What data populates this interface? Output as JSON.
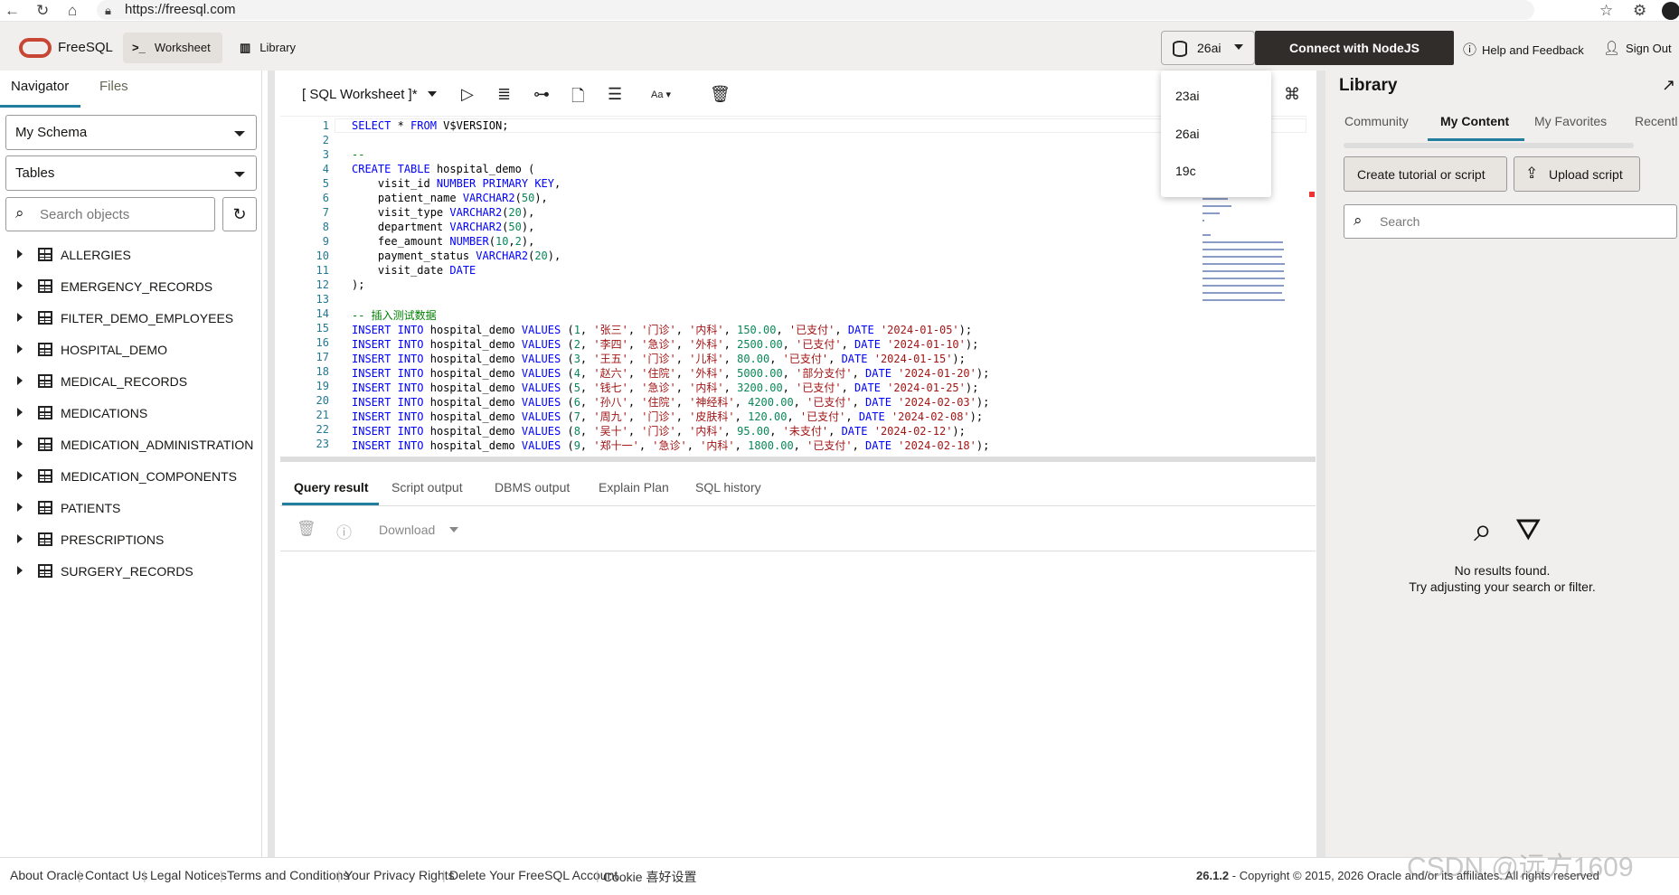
{
  "browser": {
    "url": "https://freesql.com"
  },
  "header": {
    "brand": "FreeSQL",
    "tabs": [
      {
        "label": "Worksheet",
        "icon": "terminal-icon"
      },
      {
        "label": "Library",
        "icon": "book-icon"
      }
    ],
    "db_version": "26ai",
    "connect_label": "Connect with NodeJS",
    "help_label": "Help and Feedback",
    "signout_label": "Sign Out"
  },
  "db_menu": {
    "options": [
      "23ai",
      "26ai",
      "19c"
    ]
  },
  "navigator": {
    "tabs": [
      "Navigator",
      "Files"
    ],
    "schema": "My Schema",
    "object_type": "Tables",
    "search_placeholder": "Search objects",
    "items": [
      "ALLERGIES",
      "EMERGENCY_RECORDS",
      "FILTER_DEMO_EMPLOYEES",
      "HOSPITAL_DEMO",
      "MEDICAL_RECORDS",
      "MEDICATIONS",
      "MEDICATION_ADMINISTRATION",
      "MEDICATION_COMPONENTS",
      "PATIENTS",
      "PRESCRIPTIONS",
      "SURGERY_RECORDS"
    ]
  },
  "worksheet": {
    "title": "[ SQL Worksheet ]*"
  },
  "editor": {
    "line_numbers": [
      "1",
      "2",
      "3",
      "4",
      "5",
      "6",
      "7",
      "8",
      "9",
      "10",
      "11",
      "12",
      "13",
      "14",
      "15",
      "16",
      "17",
      "18",
      "19",
      "20",
      "21",
      "22",
      "23"
    ],
    "lines": [
      "SELECT * FROM V$VERSION;",
      "",
      "--",
      "CREATE TABLE hospital_demo (",
      "    visit_id NUMBER PRIMARY KEY,",
      "    patient_name VARCHAR2(50),",
      "    visit_type VARCHAR2(20),",
      "    department VARCHAR2(50),",
      "    fee_amount NUMBER(10,2),",
      "    payment_status VARCHAR2(20),",
      "    visit_date DATE",
      ");",
      "",
      "-- 插入测试数据",
      "INSERT INTO hospital_demo VALUES (1, '张三', '门诊', '内科', 150.00, '已支付', DATE '2024-01-05');",
      "INSERT INTO hospital_demo VALUES (2, '李四', '急诊', '外科', 2500.00, '已支付', DATE '2024-01-10');",
      "INSERT INTO hospital_demo VALUES (3, '王五', '门诊', '儿科', 80.00, '已支付', DATE '2024-01-15');",
      "INSERT INTO hospital_demo VALUES (4, '赵六', '住院', '外科', 5000.00, '部分支付', DATE '2024-01-20');",
      "INSERT INTO hospital_demo VALUES (5, '钱七', '急诊', '内科', 3200.00, '已支付', DATE '2024-01-25');",
      "INSERT INTO hospital_demo VALUES (6, '孙八', '住院', '神经科', 4200.00, '已支付', DATE '2024-02-03');",
      "INSERT INTO hospital_demo VALUES (7, '周九', '门诊', '皮肤科', 120.00, '已支付', DATE '2024-02-08');",
      "INSERT INTO hospital_demo VALUES (8, '吴十', '门诊', '内科', 95.00, '未支付', DATE '2024-02-12');",
      "INSERT INTO hospital_demo VALUES (9, '郑十一', '急诊', '内科', 1800.00, '已支付', DATE '2024-02-18');"
    ]
  },
  "results": {
    "tabs": [
      "Query result",
      "Script output",
      "DBMS output",
      "Explain Plan",
      "SQL history"
    ],
    "download_label": "Download"
  },
  "library": {
    "title": "Library",
    "tabs": [
      "Community",
      "My Content",
      "My Favorites",
      "Recentl"
    ],
    "create_label": "Create tutorial or script",
    "upload_label": "Upload script",
    "search_placeholder": "Search",
    "empty_title": "No results found.",
    "empty_hint": "Try adjusting your search or filter."
  },
  "footer": {
    "links": [
      "About Oracle",
      "Contact Us",
      "Legal Notices",
      "Terms and Conditions",
      "Your Privacy Rights",
      "Delete Your FreeSQL Account",
      "Cookie 喜好设置"
    ],
    "version": "26.1.2",
    "copyright": "-  Copyright © 2015, 2026 Oracle and/or its affiliates. All rights reserved",
    "watermark": "CSDN @远方1609"
  },
  "colors": {
    "accent": "#227e9e",
    "brand_red": "#c74634",
    "connect_bg": "#312d2a"
  }
}
